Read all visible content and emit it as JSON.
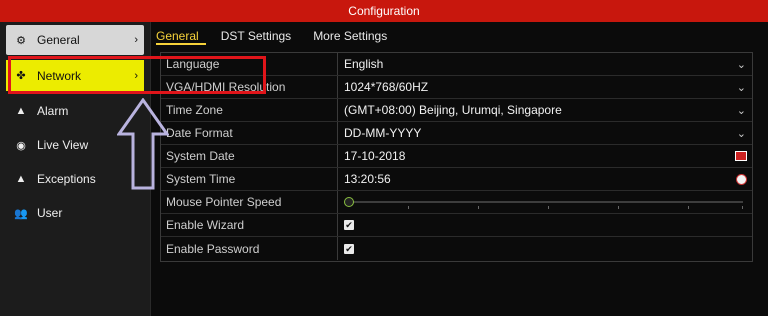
{
  "window": {
    "title": "Configuration"
  },
  "sidebar": {
    "items": [
      {
        "label": "General",
        "icon": "gear-icon",
        "glyph": "⚙",
        "chevron": "›"
      },
      {
        "label": "Network",
        "icon": "network-icon",
        "glyph": "✤",
        "chevron": "›"
      },
      {
        "label": "Alarm",
        "icon": "alarm-icon",
        "glyph": "▲"
      },
      {
        "label": "Live View",
        "icon": "eye-icon",
        "glyph": "◉"
      },
      {
        "label": "Exceptions",
        "icon": "warning-icon",
        "glyph": "▲"
      },
      {
        "label": "User",
        "icon": "users-icon",
        "glyph": "👥"
      }
    ]
  },
  "tabs": [
    {
      "label": "General",
      "active": true
    },
    {
      "label": "DST Settings",
      "active": false
    },
    {
      "label": "More Settings",
      "active": false
    }
  ],
  "settings": {
    "language": {
      "label": "Language",
      "value": "English"
    },
    "resolution": {
      "label": "VGA/HDMI Resolution",
      "value": "1024*768/60HZ"
    },
    "timezone": {
      "label": "Time Zone",
      "value": "(GMT+08:00) Beijing, Urumqi, Singapore"
    },
    "date_format": {
      "label": "Date Format",
      "value": "DD-MM-YYYY"
    },
    "system_date": {
      "label": "System Date",
      "value": "17-10-2018"
    },
    "system_time": {
      "label": "System Time",
      "value": "13:20:56"
    },
    "mouse_speed": {
      "label": "Mouse Pointer Speed"
    },
    "enable_wizard": {
      "label": "Enable Wizard",
      "checked": true
    },
    "enable_password": {
      "label": "Enable Password",
      "checked": true
    }
  },
  "colors": {
    "titlebar": "#c8170d",
    "highlight": "#ecec00",
    "accent_tab": "#f6d23a",
    "annotation_box": "#e0151a",
    "annotation_arrow": "#b9b3df"
  }
}
